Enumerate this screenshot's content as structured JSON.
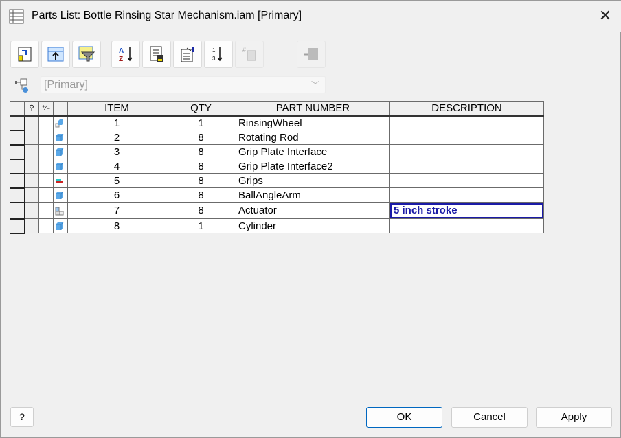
{
  "window": {
    "title": "Parts List: Bottle Rinsing Star Mechanism.iam [Primary]",
    "close_label": "✕"
  },
  "toolbar": [
    {
      "name": "item-override-button",
      "enabled": true
    },
    {
      "name": "export-parts-list-button",
      "enabled": true
    },
    {
      "name": "filter-settings-button",
      "enabled": true
    },
    {
      "name": "sort-button",
      "enabled": true
    },
    {
      "name": "save-parts-list-button",
      "enabled": true
    },
    {
      "name": "column-chooser-button",
      "enabled": true
    },
    {
      "name": "renumber-items-button",
      "enabled": true
    },
    {
      "name": "group-settings-button",
      "enabled": false
    },
    {
      "name": "member-edit-scope-button",
      "enabled": false
    }
  ],
  "bom_view": {
    "selected": "[Primary]"
  },
  "table": {
    "header_icons": {
      "col1": "⚲",
      "col2": "⁺⁄₋"
    },
    "columns": [
      "ITEM",
      "QTY",
      "PART NUMBER",
      "DESCRIPTION"
    ],
    "rows": [
      {
        "icon": "assembly-part",
        "item": "1",
        "qty": "1",
        "part_number": "RinsingWheel",
        "description": ""
      },
      {
        "icon": "part",
        "item": "2",
        "qty": "8",
        "part_number": "Rotating Rod",
        "description": ""
      },
      {
        "icon": "part",
        "item": "3",
        "qty": "8",
        "part_number": "Grip Plate Interface",
        "description": ""
      },
      {
        "icon": "part",
        "item": "4",
        "qty": "8",
        "part_number": "Grip Plate Interface2",
        "description": ""
      },
      {
        "icon": "content-center",
        "item": "5",
        "qty": "8",
        "part_number": "Grips",
        "description": ""
      },
      {
        "icon": "part",
        "item": "6",
        "qty": "8",
        "part_number": "BallAngleArm",
        "description": ""
      },
      {
        "icon": "assembly",
        "item": "7",
        "qty": "8",
        "part_number": "Actuator",
        "description": "5 inch stroke"
      },
      {
        "icon": "part",
        "item": "8",
        "qty": "1",
        "part_number": "Cylinder",
        "description": ""
      }
    ]
  },
  "footer": {
    "help_label": "?",
    "ok_label": "OK",
    "cancel_label": "Cancel",
    "apply_label": "Apply"
  },
  "colors": {
    "part_blue": "#5aa8e8",
    "edit_blue": "#1a1aa6",
    "primary_border": "#0067c0"
  }
}
